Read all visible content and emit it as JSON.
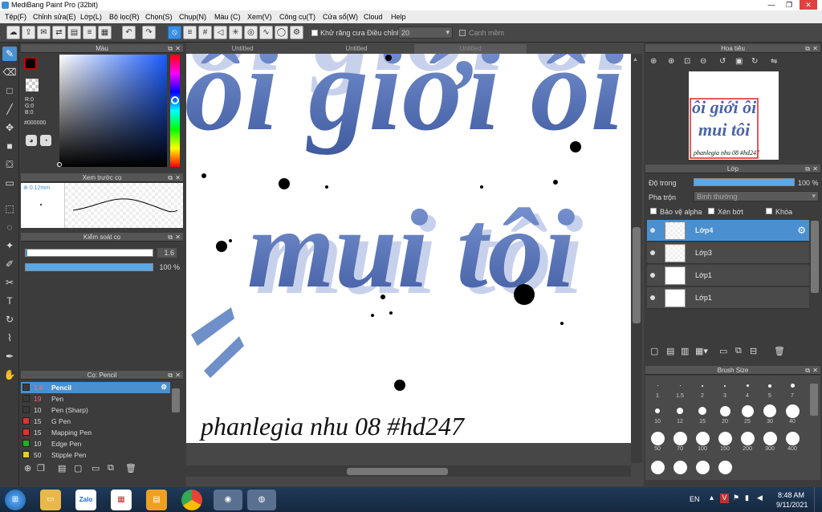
{
  "window": {
    "title": "MediBang Paint Pro (32bit)",
    "minimize": "—",
    "maximize": "❐",
    "close": "✕"
  },
  "menu": [
    "Tệp(F)",
    "Chỉnh sửa(E)",
    "Lớp(L)",
    "Bộ lọc(R)",
    "Chọn(S)",
    "Chụp(N)",
    "Màu (C)",
    "Xem(V)",
    "Công cụ(T)",
    "Cửa sổ(W)",
    "Cloud",
    "Help"
  ],
  "toolbar": {
    "antialias_label": "Khử răng cưa",
    "adjust_label": "Điều chỉnh",
    "adjust_value": "20",
    "edge_label": "Cạnh mềm"
  },
  "color_panel": {
    "title": "Màu",
    "r": "R:0",
    "g": "G:0",
    "b": "B:0",
    "hex": "#000000",
    "primary": "#000000",
    "secondary": "#ffffff"
  },
  "brush_preview": {
    "title": "Xem trước cọ",
    "size": "0.12mm"
  },
  "brush_control": {
    "title": "Kiểm soát cọ",
    "size_value": "1.6",
    "opacity_value": "100 %"
  },
  "brush_list": {
    "title": "Cọ: Pencil",
    "items": [
      {
        "size": "1.6",
        "name": "Pencil",
        "color": "#3a3a3a",
        "selected": true
      },
      {
        "size": "19",
        "name": "Pen",
        "color": "#3a3a3a"
      },
      {
        "size": "10",
        "name": "Pen (Sharp)",
        "color": "#3a3a3a"
      },
      {
        "size": "15",
        "name": "G Pen",
        "color": "#e03030"
      },
      {
        "size": "15",
        "name": "Mapping Pen",
        "color": "#e03030"
      },
      {
        "size": "10",
        "name": "Edge Pen",
        "color": "#20b020"
      },
      {
        "size": "50",
        "name": "Stipple Pen",
        "color": "#e0d020"
      }
    ]
  },
  "tabs": [
    "Untitled",
    "Untitled",
    "Untitled"
  ],
  "canvas": {
    "line1": "ôi giới ôi",
    "line2": "mui tôi",
    "signature": "phanlegia nhu 08 #hd247"
  },
  "navigator": {
    "title": "Hoa tiêu",
    "thumb_line1": "ôi giới ôi",
    "thumb_line2": "mui tôi",
    "thumb_signature": "phanlegia nhu 08 #hd247"
  },
  "layer_panel": {
    "title": "Lớp",
    "opacity_label": "Độ trong",
    "opacity_value": "100 %",
    "blend_label": "Pha trộn",
    "blend_value": "Bình thường",
    "protect_alpha": "Bảo vệ alpha",
    "clipping": "Xén bớt",
    "lock": "Khóa",
    "layers": [
      {
        "name": "Lớp4",
        "selected": true
      },
      {
        "name": "Lớp3"
      },
      {
        "name": "Lớp1"
      },
      {
        "name": "Lớp1"
      }
    ]
  },
  "brush_size": {
    "title": "Brush Size",
    "sizes": [
      "1",
      "1.5",
      "2",
      "3",
      "4",
      "5",
      "7",
      "10",
      "12",
      "15",
      "20",
      "25",
      "30",
      "40",
      "50",
      "70",
      "100",
      "150",
      "200",
      "300",
      "400",
      "",
      "",
      "",
      ""
    ]
  },
  "taskbar": {
    "lang": "EN",
    "time": "8:48 AM",
    "date": "9/11/2021",
    "apps": [
      "Explorer",
      "Zalo",
      "Office",
      "Notes",
      "Chrome",
      "MediBang",
      "Chrome Canary"
    ]
  },
  "colors": {
    "accent": "#4a90d0",
    "text_blue": "#4a64a8"
  }
}
